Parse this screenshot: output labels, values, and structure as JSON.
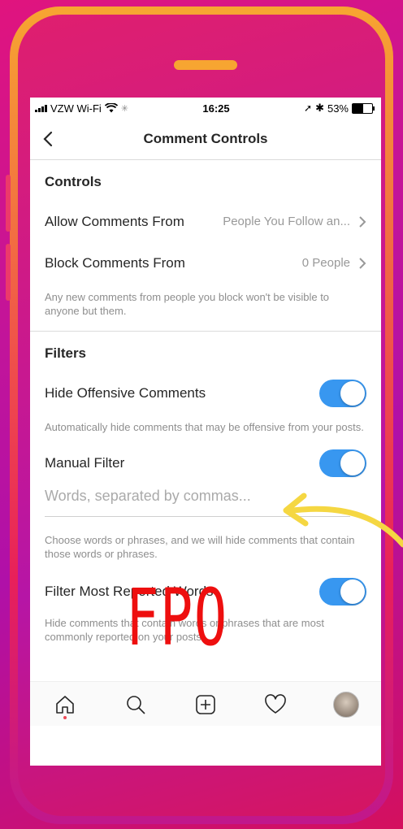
{
  "status_bar": {
    "carrier": "VZW Wi-Fi",
    "time": "16:25",
    "battery_percent": "53%",
    "battery_level": 0.53
  },
  "nav": {
    "title": "Comment Controls"
  },
  "controls_section": {
    "header": "Controls",
    "allow_comments": {
      "label": "Allow Comments From",
      "value": "People You Follow an..."
    },
    "block_comments": {
      "label": "Block Comments From",
      "value": "0 People"
    },
    "help": "Any new comments from people you block won't be visible to anyone but them."
  },
  "filters_section": {
    "header": "Filters",
    "hide_offensive": {
      "label": "Hide Offensive Comments",
      "enabled": true,
      "help": "Automatically hide comments that may be offensive from your posts."
    },
    "manual_filter": {
      "label": "Manual Filter",
      "enabled": true,
      "placeholder": "Words, separated by commas...",
      "help": "Choose words or phrases, and we will hide comments that contain those words or phrases."
    },
    "most_reported": {
      "label": "Filter Most Reported Words",
      "enabled": true,
      "help": "Hide comments that contain words or phrases that are most commonly reported on your posts."
    }
  },
  "tab_bar": {
    "items": [
      "home-icon",
      "search-icon",
      "add-post-icon",
      "activity-heart-icon",
      "profile-avatar"
    ]
  },
  "overlay": {
    "stamp": "FPO"
  },
  "colors": {
    "toggle_on": "#3897f0",
    "fpo_red": "#ee0f0f",
    "arrow_yellow": "#f5d742",
    "frame_orange": "#f7a531"
  }
}
